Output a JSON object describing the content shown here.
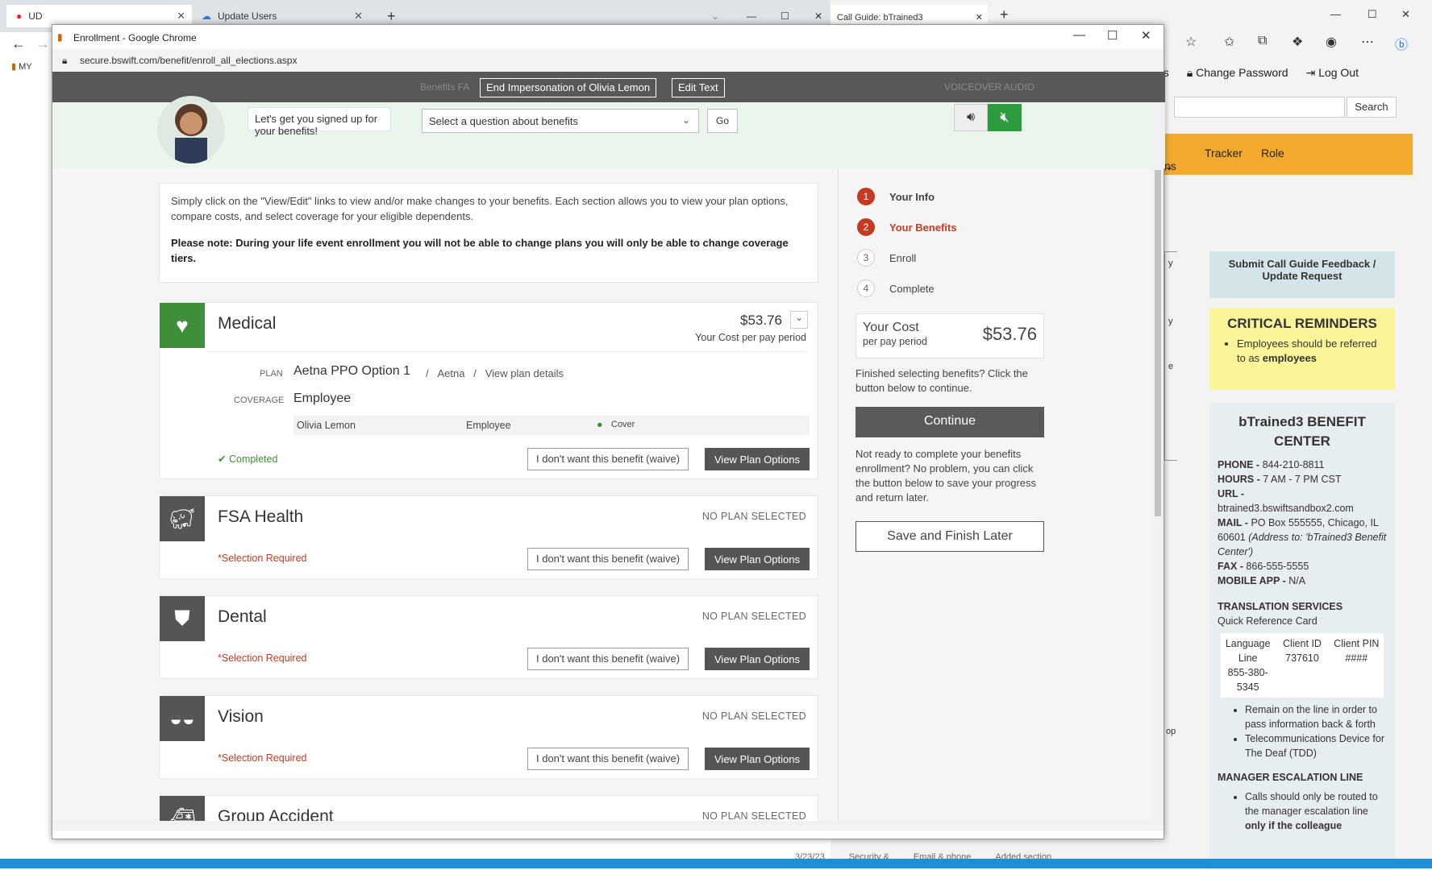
{
  "bg_left": {
    "tabs": [
      {
        "label": "UD"
      },
      {
        "label": "Update Users"
      }
    ],
    "bookmark_label": "MY"
  },
  "bg_right": {
    "tab_label": "Call Guide: bTrained3",
    "nav": [
      "erences",
      "Change Password",
      "Log Out"
    ],
    "search_label": "Search",
    "orange_items": [
      "ns",
      "Tracker",
      "Role"
    ],
    "side_letters": [
      "y",
      "y",
      "e",
      "op"
    ],
    "feedback": "Submit Call Guide Feedback / Update Request",
    "critical": {
      "title": "CRITICAL REMINDERS",
      "item_prefix": "Employees should be referred to as ",
      "item_bold": "employees"
    },
    "center": {
      "title": "bTrained3 BENEFIT CENTER",
      "phone_label": "PHONE - ",
      "phone": "844-210-8811",
      "hours_label": "HOURS - ",
      "hours": "7 AM - 7 PM CST",
      "url_label": "URL -",
      "url": "btrained3.bswiftsandbox2.com",
      "mail_label": "MAIL - ",
      "mail": "PO Box 555555, Chicago, IL 60601 ",
      "mail_note": "(Address to: 'bTrained3 Benefit Center')",
      "fax_label": "FAX - ",
      "fax": "866-555-5555",
      "app_label": "MOBILE APP - ",
      "app": "N/A",
      "translation_title": "TRANSLATION SERVICES",
      "translation_sub": "Quick Reference Card",
      "translation_cols": [
        {
          "head": "Language Line",
          "val": "855-380-5345"
        },
        {
          "head": "Client ID",
          "val": "737610"
        },
        {
          "head": "Client PIN",
          "val": "####"
        }
      ],
      "bullets": [
        "Remain on the line in order to pass information back & forth",
        "Telecommunications Device for The Deaf (TDD)"
      ],
      "escalation_title": "MANAGER ESCALATION LINE",
      "escalation_text": "Calls should only be routed to the manager escalation line ",
      "escalation_bold": "only if the colleague"
    },
    "footer_bits": [
      "3/23/23",
      "Security &",
      "Email & phone",
      "Added section"
    ]
  },
  "popup": {
    "title": "Enrollment - Google Chrome",
    "url": "secure.bswift.com/benefit/enroll_all_elections.aspx",
    "toolbar": {
      "end_impersonation": "End Impersonation of Olivia Lemon",
      "edit_text": "Edit Text"
    },
    "bubble_text": "Let's get you signed up for your benefits!",
    "faded_labels": {
      "benefits_faq": "Benefits FA",
      "voiceover": "VOICEOVER AUDIO"
    },
    "question_placeholder": "Select a question about benefits",
    "go_label": "Go",
    "intro_text": "Simply click on the \"View/Edit\" links to view and/or make changes to your benefits. Each section allows you to view your plan options, compare costs, and select coverage for your eligible dependents.",
    "intro_note": "Please note: During your life event enrollment you will not be able to change plans you will only be able to change coverage tiers.",
    "medical": {
      "name": "Medical",
      "cost": "$53.76",
      "cost_label": "Your Cost per pay period",
      "plan_label": "PLAN",
      "plan": "Aetna PPO Option 1",
      "carrier": "Aetna",
      "view_details": "View plan details",
      "coverage_label": "COVERAGE",
      "coverage": "Employee",
      "member_name": "Olivia Lemon",
      "member_relation": "Employee",
      "member_status": "Cover",
      "status": "Completed",
      "color": "#3f8f3a"
    },
    "benefits": [
      {
        "name": "FSA Health",
        "status": "NO PLAN SELECTED",
        "req": "*Selection Required",
        "icon": "piggy-bank-icon"
      },
      {
        "name": "Dental",
        "status": "NO PLAN SELECTED",
        "req": "*Selection Required",
        "icon": "tooth-icon"
      },
      {
        "name": "Vision",
        "status": "NO PLAN SELECTED",
        "req": "*Selection Required",
        "icon": "glasses-icon"
      },
      {
        "name": "Group Accident",
        "status": "NO PLAN SELECTED",
        "req": "",
        "icon": "ambulance-icon"
      }
    ],
    "waive_label": "I don't want this benefit (waive)",
    "view_options_label": "View Plan Options",
    "steps": [
      {
        "num": "1",
        "label": "Your Info"
      },
      {
        "num": "2",
        "label": "Your Benefits"
      },
      {
        "num": "3",
        "label": "Enroll"
      },
      {
        "num": "4",
        "label": "Complete"
      }
    ],
    "your_cost_label": "Your Cost",
    "per_pay": "per pay period",
    "your_cost": "$53.76",
    "finished_text": "Finished selecting benefits? Click the button below to continue.",
    "continue_label": "Continue",
    "not_ready_text": "Not ready to complete your benefits enrollment? No problem, you can click the button below to save your progress and return later.",
    "save_label": "Save and Finish Later"
  }
}
